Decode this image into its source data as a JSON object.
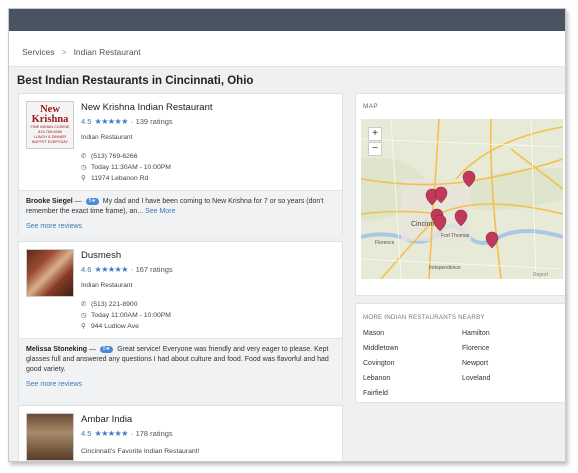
{
  "breadcrumb": {
    "services": "Services",
    "separator": ">",
    "current": "Indian Restaurant"
  },
  "page_title": "Best Indian Restaurants in Cincinnati, Ohio",
  "restaurants": [
    {
      "name": "New Krishna Indian Restaurant",
      "rating": "4.5",
      "stars": "★★★★★",
      "ratings_count": "· 139 ratings",
      "category": "Indian Restaurant",
      "phone": "(513) 769-6266",
      "hours": "Today 11:30AM - 10:00PM",
      "address": "11974 Lebanon Rd",
      "thumb_text": {
        "line1": "New",
        "line2": "Krishna",
        "line3": "FINE INDIAN CUISINE",
        "line4": "513-769-6266",
        "line5": "LUNCH & DINNER",
        "line6": "BUFFET EVERYDAY"
      },
      "review": {
        "author": "Brooke Siegel",
        "dash": " — ",
        "badge": "5★",
        "text": "My dad and I have been coming to New Krishna for 7 or so years (don't remember the exact time frame), an...",
        "more": "See More",
        "see_more_reviews": "See more reviews"
      }
    },
    {
      "name": "Dusmesh",
      "rating": "4.6",
      "stars": "★★★★★",
      "ratings_count": "· 167 ratings",
      "category": "Indian Restaurant",
      "phone": "(513) 221-8900",
      "hours": "Today 11:00AM - 10:00PM",
      "address": "944 Ludlow Ave",
      "review": {
        "author": "Melissa Stoneking",
        "dash": " — ",
        "badge": "5★",
        "text": "Great service! Everyone was friendly and very eager to please. Kept glasses full and answered any questions I had about culture and food. Food was flavorful and had good variety.",
        "see_more_reviews": "See more reviews"
      }
    },
    {
      "name": "Ambar India",
      "rating": "4.5",
      "stars": "★★★★★",
      "ratings_count": "· 178 ratings",
      "description": "Cincinnati's Favorite Indian Restaurant!"
    }
  ],
  "map": {
    "label": "MAP",
    "zoom_in": "+",
    "zoom_out": "−",
    "places": {
      "cincinnati": "Cincinnati",
      "independence": "Independence",
      "florence": "Florence",
      "fort_thomas": "Fort Thomas"
    },
    "credit": "Report",
    "pin_color": "#c0395a"
  },
  "nearby": {
    "label": "MORE INDIAN RESTAURANTS NEARBY",
    "cities": [
      "Mason",
      "Hamilton",
      "Middletown",
      "Florence",
      "Covington",
      "Newport",
      "Lebanon",
      "Loveland",
      "Fairfield"
    ]
  }
}
